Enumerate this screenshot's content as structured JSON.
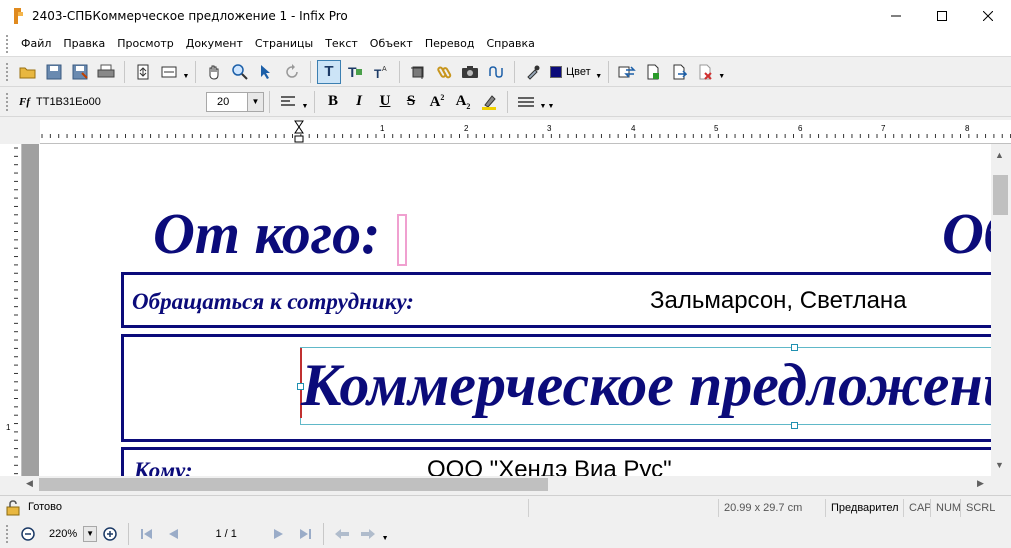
{
  "window": {
    "title": "2403-СПБКоммерческое предложение 1 - Infix Pro"
  },
  "menu": [
    "Файл",
    "Правка",
    "Просмотр",
    "Документ",
    "Страницы",
    "Текст",
    "Объект",
    "Перевод",
    "Справка"
  ],
  "toolbar1": {
    "color_label": "Цвет"
  },
  "toolbar2": {
    "font_name": "TT1B31Eo00",
    "font_size": "20"
  },
  "ruler": {
    "h_labels": [
      "1",
      "2",
      "3",
      "4",
      "5",
      "6",
      "7",
      "8"
    ],
    "v_label": "1"
  },
  "document": {
    "from_label": "От кого:",
    "right_partial": "Oб",
    "contact_label": "Обращаться к сотруднику:",
    "contact_value": "Зальмарсон, Светлана",
    "heading": "Коммерческое предложени",
    "to_label": "Кому:",
    "to_value": "ООО \"Хендэ Виа Рус\""
  },
  "status": {
    "ready": "Готово",
    "page_size": "20.99 x 29.7 cm",
    "mode": "Предварител",
    "cap": "CAP",
    "num": "NUM",
    "scrl": "SCRL"
  },
  "nav": {
    "zoom": "220%",
    "page": "1 / 1"
  },
  "colors": {
    "accent_blue": "#0b0b7a",
    "toolbar_bg": "#f0f0f0"
  }
}
